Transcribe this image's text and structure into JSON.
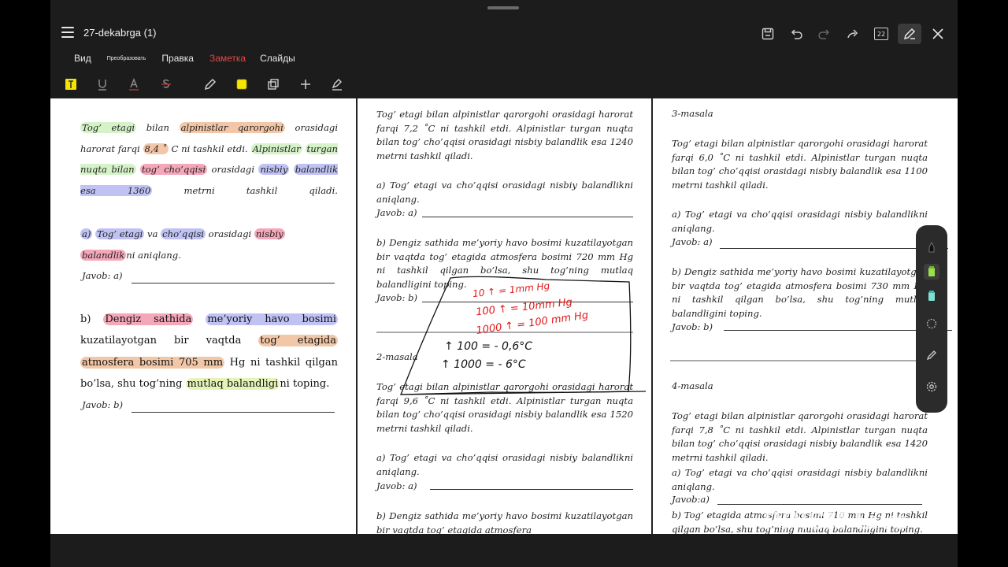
{
  "app": {
    "doc_title": "27-dekabrga (1)",
    "menu": [
      {
        "label": "Вид"
      },
      {
        "label": "Преобразовать"
      },
      {
        "label": "Правка"
      },
      {
        "label": "Заметка"
      },
      {
        "label": "Слайды"
      }
    ],
    "page_badge": "22",
    "accent": "#e04848",
    "highlighter_color": "#f5e400"
  },
  "col1": {
    "p1": [
      "Tog’ etagi",
      "bilan",
      "alpinistlar qarorgohi",
      "orasidagi",
      "harorat farqi",
      "8,4 ˚",
      "C ni tashkil etdi.",
      "Alpinistlar",
      "turgan nuqta bilan",
      "tog’ cho’qqisi",
      "orasidagi",
      "nisbiy",
      "balandlik esa 1360",
      "metrni tashkil qiladi."
    ],
    "qa": [
      "a)",
      "Tog’ etagi",
      "va",
      "cho’qqisi",
      "orasidagi",
      "nisbiy",
      "balandlik",
      "ni aniqlang."
    ],
    "javob_a": "Javob: a)",
    "qb": [
      "b)",
      "Dengiz sathida",
      "me’yoriy havo bosimi",
      "kuzatilayotgan bir vaqtda",
      "tog’ etagida",
      "atmosfera bosimi 705 mm",
      "Hg ni tashkil qilgan",
      "bo’lsa, shu tog’ning",
      "mutlaq balandligi",
      "ni toping."
    ],
    "javob_b": "Javob: b)"
  },
  "col2": {
    "p1": "Tog’ etagi bilan alpinistlar qarorgohi orasidagi harorat farqi 7,2 ˚C ni tashkil etdi. Alpinistlar turgan nuqta bilan tog’ cho’qqisi orasidagi nisbiy balandlik esa 1240 metrni tashkil qiladi.",
    "qa": "a) Tog’ etagi va cho’qqisi orasidagi nisbiy balandlikni aniqlang.",
    "javob_a": "Javob: a)",
    "qb": "b) Dengiz sathida me’yoriy havo bosimi kuzatilayotgan bir vaqtda tog’ etagida atmosfera bosimi 720 mm Hg ni tashkil qilgan bo’lsa, shu tog’ning mutlaq balandligini toping.",
    "javob_b": "Javob: b)",
    "section2": "2-masala",
    "p2": "Tog’ etagi bilan alpinistlar qarorgohi orasidagi harorat farqi 9,6 ˚C ni tashkil etdi. Alpinistlar turgan nuqta bilan tog’ cho’qqisi orasidagi nisbiy balandlik esa 1520 metrni tashkil qiladi.",
    "qa2": "a) Tog’ etagi va cho’qqisi orasidagi nisbiy balandlikni aniqlang.",
    "javob_a2": "Javob: a)",
    "qb2": "b) Dengiz sathida me’yoriy havo bosimi kuzatilayotgan bir vaqtda tog’ etagida atmosfera",
    "handwriting": {
      "red1": "10 ↑ = 1mm Hg",
      "red2": "100 ↑ = 10mm Hg",
      "red3": "1000 ↑ = 100 mm Hg",
      "blk1": "↑ 100 = - 0,6°C",
      "blk2": "↑ 1000 = - 6°C"
    }
  },
  "col3": {
    "section3": "3-masala",
    "p1": "Tog’ etagi bilan alpinistlar qarorgohi orasidagi harorat farqi 6,0 ˚C ni tashkil etdi. Alpinistlar turgan nuqta bilan tog’ cho’qqisi orasidagi nisbiy balandlik esa 1100 metrni tashkil qiladi.",
    "qa": "a) Tog’ etagi va cho’qqisi orasidagi nisbiy balandlikni aniqlang.",
    "javob_a": "Javob: a)",
    "qb": "b) Dengiz sathida me’yoriy havo bosimi kuzatilayotgan bir vaqtda tog’ etagida atmosfera bosimi 730 mm Hg ni tashkil qilgan bo’lsa, shu tog’ning mutlaq balandligini toping.",
    "javob_b": "Javob: b)",
    "section4": "4-masala",
    "p2": "Tog’ etagi bilan alpinistlar qarorgohi orasidagi harorat farqi 7,8 ˚C ni tashkil etdi. Alpinistlar turgan nuqta bilan tog’ cho’qqisi orasidagi nisbiy balandlik esa 1420 metrni tashkil qiladi.",
    "qa2": "a) Tog’ etagi va cho’qqisi orasidagi nisbiy balandlikni aniqlang.",
    "javob_a2": "Javob:a)",
    "qb2": "b) Tog’ etagida atmosfera bosimi 710 mm Hg ni tashkil qilgan bo’lsa, shu tog’ning mutlaq balandligini toping."
  },
  "watermark": "PRISM Live"
}
